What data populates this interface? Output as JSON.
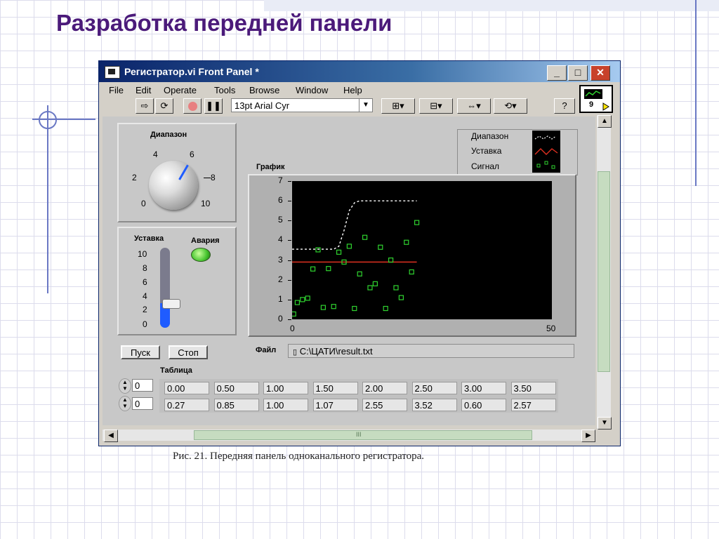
{
  "slide": {
    "title": "Разработка передней панели",
    "caption": "Рис. 21. Передняя панель одноканального регистратора."
  },
  "window": {
    "title": "Регистратор.vi Front Panel *",
    "minimize_label": "_",
    "maximize_label": "□",
    "close_label": "✕",
    "menu": [
      "File",
      "Edit",
      "Operate",
      "Tools",
      "Browse",
      "Window",
      "Help"
    ],
    "toolbar": {
      "font_select": "13pt Arial Cyr",
      "help_label": "?",
      "vi_icon_number": "9"
    }
  },
  "panel": {
    "range_label": "Диапазон",
    "knob_ticks": [
      "0",
      "2",
      "4",
      "6",
      "8",
      "10"
    ],
    "setpoint_label": "Уставка",
    "slider_ticks": [
      "10",
      "8",
      "6",
      "4",
      "2",
      "0"
    ],
    "setpoint_value": 3,
    "alarm_label": "Авария",
    "start_button": "Пуск",
    "stop_button": "Стоп",
    "graph_label": "График",
    "legend": [
      "Диапазон",
      "Уставка",
      "Сигнал"
    ],
    "file_label": "Файл",
    "file_path": "C:\\ЦАТИ\\result.txt",
    "table_label": "Таблица",
    "row_index": [
      "0",
      "0"
    ],
    "table": [
      [
        "0.00",
        "0.50",
        "1.00",
        "1.50",
        "2.00",
        "2.50",
        "3.00",
        "3.50"
      ],
      [
        "0.27",
        "0.85",
        "1.00",
        "1.07",
        "2.55",
        "3.52",
        "0.60",
        "2.57"
      ]
    ],
    "hscroll_label": "III"
  },
  "chart_data": {
    "type": "scatter",
    "title": "График",
    "xlabel": "",
    "ylabel": "",
    "xlim": [
      0,
      50
    ],
    "ylim": [
      0,
      7
    ],
    "x_ticks": [
      "0",
      "50"
    ],
    "y_ticks": [
      "0",
      "1",
      "2",
      "3",
      "4",
      "5",
      "6",
      "7"
    ],
    "series": [
      {
        "name": "Диапазон",
        "style": "dashed-line",
        "color": "#ffffff",
        "x": [
          0,
          6,
          8,
          9,
          10,
          11,
          12,
          13,
          24
        ],
        "y": [
          3.55,
          3.55,
          3.55,
          3.7,
          4.5,
          5.5,
          5.9,
          6.0,
          6.0
        ]
      },
      {
        "name": "Уставка",
        "style": "line",
        "color": "#e03020",
        "x": [
          0,
          24
        ],
        "y": [
          2.9,
          2.9
        ]
      },
      {
        "name": "Сигнал",
        "style": "markers",
        "color": "#2fd32f",
        "x": [
          0.3,
          1,
          2,
          3,
          4,
          5,
          6,
          7,
          8,
          9,
          10,
          11,
          12,
          13,
          14,
          15,
          16,
          17,
          18,
          19,
          20,
          21,
          22,
          23,
          24
        ],
        "y": [
          0.27,
          0.85,
          1.0,
          1.07,
          2.55,
          3.52,
          0.6,
          2.57,
          0.65,
          3.4,
          2.9,
          3.7,
          0.55,
          2.3,
          4.15,
          1.6,
          1.8,
          3.65,
          0.55,
          3.0,
          1.6,
          1.1,
          3.9,
          2.4,
          4.9
        ]
      }
    ]
  }
}
